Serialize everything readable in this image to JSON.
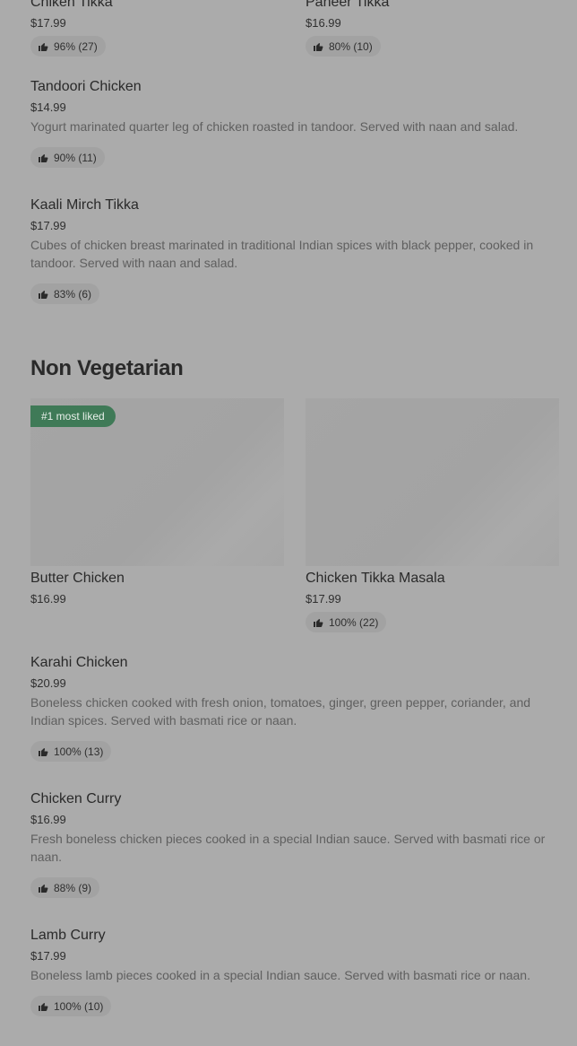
{
  "top_cards": [
    {
      "name": "Chiken Tikka",
      "price": "$17.99",
      "rating": "96% (27)"
    },
    {
      "name": "Paneer Tikka",
      "price": "$16.99",
      "rating": "80% (10)"
    }
  ],
  "list_items_1": [
    {
      "name": "Tandoori Chicken",
      "price": "$14.99",
      "description": "Yogurt marinated quarter leg of chicken roasted in tandoor. Served with naan and salad.",
      "rating": "90% (11)"
    },
    {
      "name": "Kaali Mirch Tikka",
      "price": "$17.99",
      "description": "Cubes of chicken breast marinated in traditional Indian spices with black pepper, cooked in tandoor. Served with naan and salad.",
      "rating": "83% (6)"
    }
  ],
  "section": {
    "title": "Non Vegetarian"
  },
  "featured": [
    {
      "badge": "#1 most liked",
      "name": "Butter Chicken",
      "price": "$16.99"
    },
    {
      "name": "Chicken Tikka Masala",
      "price": "$17.99",
      "rating": "100% (22)"
    }
  ],
  "list_items_2": [
    {
      "name": "Karahi Chicken",
      "price": "$20.99",
      "description": "Boneless chicken cooked with fresh onion, tomatoes, ginger, green pepper, coriander, and Indian spices. Served with basmati rice or naan.",
      "rating": "100% (13)"
    },
    {
      "name": "Chicken Curry",
      "price": "$16.99",
      "description": "Fresh boneless chicken pieces cooked in a special Indian sauce. Served with basmati rice or naan.",
      "rating": "88% (9)"
    },
    {
      "name": "Lamb Curry",
      "price": "$17.99",
      "description": "Boneless lamb pieces cooked in a special Indian sauce. Served with basmati rice or naan.",
      "rating": "100% (10)"
    }
  ],
  "icons": {
    "rating": "thumbs-up-icon"
  }
}
